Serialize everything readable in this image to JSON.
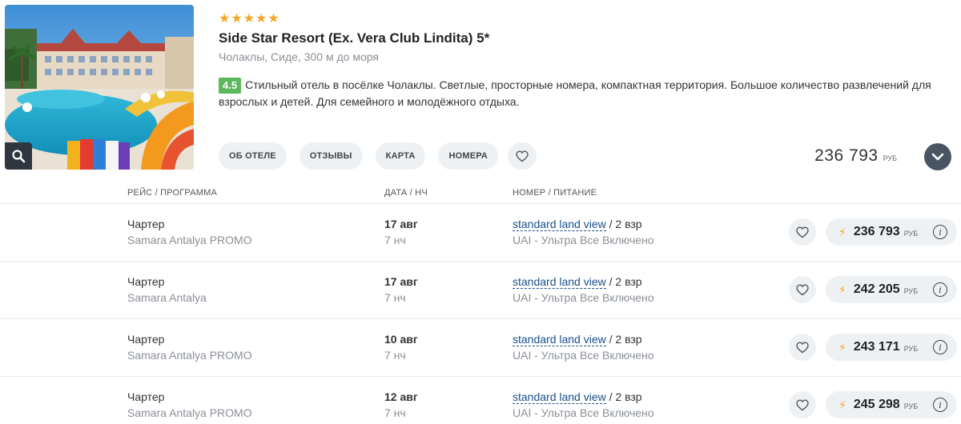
{
  "hotel": {
    "stars": 5,
    "name": "Side Star Resort (Ex. Vera Club Lindita) 5*",
    "location": "Чолаклы, Сиде, 300 м до моря",
    "rating": "4.5",
    "description": "Стильный отель в посёлке Чолаклы. Светлые, просторные номера, компактная территория. Большое количество развлечений для взрослых и детей. Для семейного и молодёжного отдыха."
  },
  "tabs": {
    "about": "ОБ ОТЕЛЕ",
    "reviews": "ОТЗЫВЫ",
    "map": "КАРТА",
    "rooms": "НОМЕРА"
  },
  "top_price": {
    "amount": "236 793",
    "currency": "РУБ"
  },
  "columns": {
    "flight": "РЕЙС / ПРОГРАММА",
    "date": "ДАТА / НЧ",
    "room": "НОМЕР / ПИТАНИЕ"
  },
  "offers": [
    {
      "flight": "Чартер",
      "program": "Samara Antalya PROMO",
      "date": "17 авг",
      "nights": "7 нч",
      "room": "standard land view",
      "guests": " / 2 взр",
      "meal": "UAI - Ультра Все Включено",
      "price": "236 793",
      "currency": "РУБ"
    },
    {
      "flight": "Чартер",
      "program": "Samara Antalya",
      "date": "17 авг",
      "nights": "7 нч",
      "room": "standard land view",
      "guests": " / 2 взр",
      "meal": "UAI - Ультра Все Включено",
      "price": "242 205",
      "currency": "РУБ"
    },
    {
      "flight": "Чартер",
      "program": "Samara Antalya PROMO",
      "date": "10 авг",
      "nights": "7 нч",
      "room": "standard land view",
      "guests": " / 2 взр",
      "meal": "UAI - Ультра Все Включено",
      "price": "243 171",
      "currency": "РУБ"
    },
    {
      "flight": "Чартер",
      "program": "Samara Antalya PROMO",
      "date": "12 авг",
      "nights": "7 нч",
      "room": "standard land view",
      "guests": " / 2 взр",
      "meal": "UAI - Ультра Все Включено",
      "price": "245 298",
      "currency": "РУБ"
    }
  ],
  "icons": {
    "zoom": "search-icon",
    "favorite": "heart-icon",
    "expand": "chevron-down-icon",
    "hot_price": "lightning-icon",
    "info": "info-icon",
    "star": "star-icon"
  },
  "colors": {
    "star": "#f5a623",
    "rating_badge": "#5cb85c",
    "link": "#1a4f8b",
    "button_bg": "#eef1f4",
    "expand_bg": "#4a5564"
  }
}
